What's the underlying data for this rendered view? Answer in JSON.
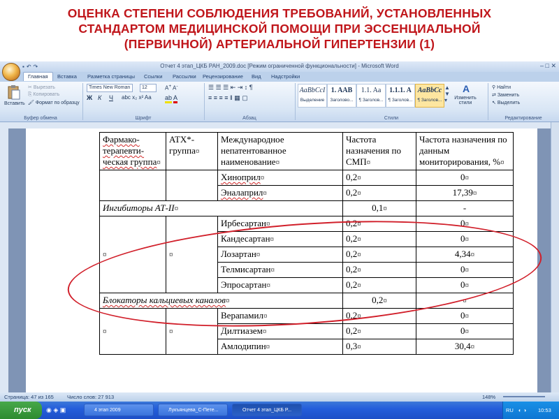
{
  "slide": {
    "title_lines": [
      "ОЦЕНКА СТЕПЕНИ СОБЛЮДЕНИЯ ТРЕБОВАНИЙ, УСТАНОВЛЕННЫХ",
      "СТАНДАРТОМ  МЕДИЦИНСКОЙ ПОМОЩИ ПРИ ЭССЕНЦИАЛЬНОЙ",
      "(ПЕРВИЧНОЙ) АРТЕРИАЛЬНОЙ ГИПЕРТЕНЗИИ (1)"
    ]
  },
  "window": {
    "title": "Отчет 4 этап_ЦКБ РАН_2009.doc [Режим ограниченной функциональности] - Microsoft Word",
    "tabs": [
      "Главная",
      "Вставка",
      "Разметка страницы",
      "Ссылки",
      "Рассылки",
      "Рецензирование",
      "Вид",
      "Надстройки"
    ]
  },
  "ribbon": {
    "clipboard": {
      "paste": "Вставить",
      "cut": "Вырезать",
      "copy": "Копировать",
      "format_painter": "Формат по образцу",
      "label": "Буфер обмена"
    },
    "font": {
      "name": "Times New Roman",
      "size": "12",
      "label": "Шрифт",
      "bold": "Ж",
      "italic": "К",
      "underline": "Ч"
    },
    "paragraph": {
      "label": "Абзац"
    },
    "styles": {
      "label": "Стили",
      "items": [
        {
          "sample": "AaBbCcI",
          "name": "Выделение"
        },
        {
          "sample": "1. AAB",
          "name": "Заголово..."
        },
        {
          "sample": "1.1. Aa",
          "name": "¶ Заголов..."
        },
        {
          "sample": "1.1.1. A",
          "name": "¶ Заголов..."
        },
        {
          "sample": "AaBbCc",
          "name": "¶ Заголов..."
        }
      ],
      "change": "Изменить стили"
    },
    "editing": {
      "find": "Найти",
      "replace": "Заменить",
      "select": "Выделить",
      "label": "Редактирование"
    }
  },
  "table": {
    "headers": {
      "group": "Фармако-терапевти-ческая группа",
      "atc": "ATX*-группа",
      "inn": "Международное непатентованное наименование",
      "freq_smp": "Частота назначения по СМП",
      "freq_monitor": "Частота назначения по данным мониторирования, %"
    },
    "rows": [
      {
        "name": "Хиноприл",
        "smp": "0,2",
        "mon": "0"
      },
      {
        "name": "Эналаприл",
        "smp": "0,2",
        "mon": "17,39"
      }
    ],
    "group_ace_inhib": {
      "label": "Ингибиторы АТ-II",
      "smp": "0,1",
      "mon": "-"
    },
    "sartans": [
      {
        "name": "Ирбесартан",
        "smp": "0,2",
        "mon": "0"
      },
      {
        "name": "Кандесартан",
        "smp": "0,2",
        "mon": "0"
      },
      {
        "name": "Лозартан",
        "smp": "0,2",
        "mon": "4,34"
      },
      {
        "name": "Телмисартан",
        "smp": "0,2",
        "mon": "0"
      },
      {
        "name": "Эпросартан",
        "smp": "0,2",
        "mon": "0"
      }
    ],
    "group_ccb": {
      "label": "Блокаторы кальциевых каналов",
      "smp": "0,2",
      "mon": ""
    },
    "ccb": [
      {
        "name": "Верапамил",
        "smp": "0,2",
        "mon": "0"
      },
      {
        "name": "Дилтиазем",
        "smp": "0,2",
        "mon": "0"
      },
      {
        "name": "Амлодипин",
        "smp": "0,3",
        "mon": "30,4"
      }
    ]
  },
  "status": {
    "page": "Страница: 47 из 165",
    "words": "Число слов: 27 913",
    "zoom": "148%"
  },
  "taskbar": {
    "start": "пуск",
    "tasks": [
      "4 этап 2009",
      "Лукъянцева_С-Пете...",
      "Отчет 4 этап_ЦКБ Р..."
    ],
    "lang": "RU",
    "time": "10:53"
  }
}
